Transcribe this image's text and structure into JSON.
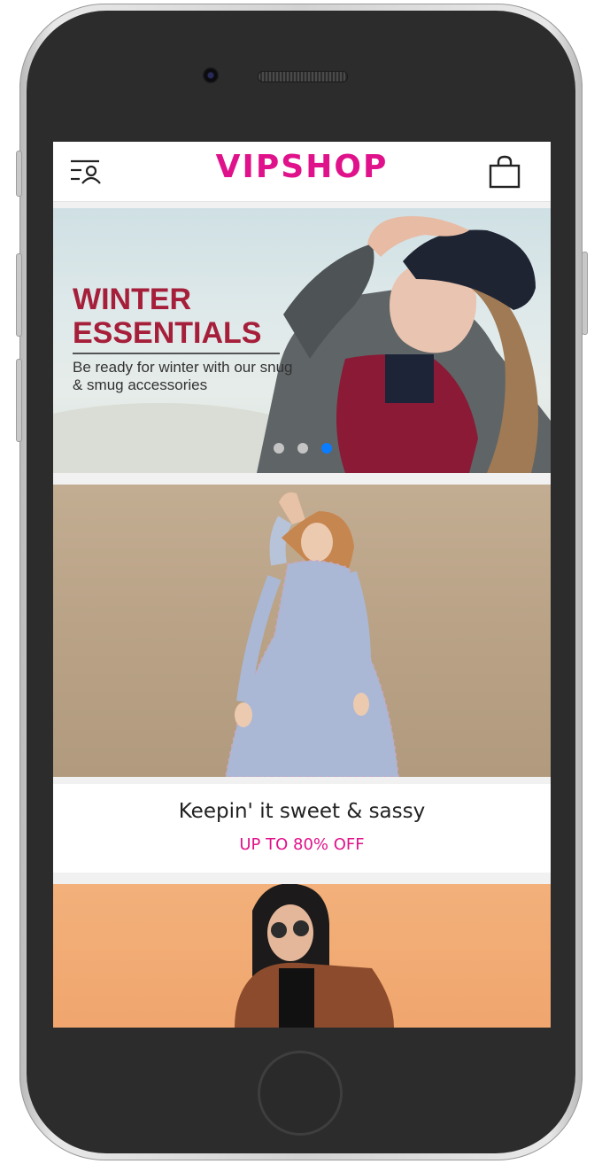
{
  "navbar": {
    "brand": "VIPSHOP",
    "menu_icon": "user-menu-icon",
    "cart_icon": "shopping-bag-icon"
  },
  "banner": {
    "title_line1": "WINTER",
    "title_line2": "ESSENTIALS",
    "subtitle": "Be ready for winter with our snug & smug accessories",
    "slides_total": 3,
    "active_slide": 3,
    "title_color": "#a61f3a"
  },
  "promo": {
    "title": "Keepin' it sweet & sassy",
    "subtitle": "UP TO 80% OFF"
  },
  "colors": {
    "brand": "#e0128b",
    "dot_active": "#0a7cff",
    "dot_inactive": "#c4c4c4"
  }
}
